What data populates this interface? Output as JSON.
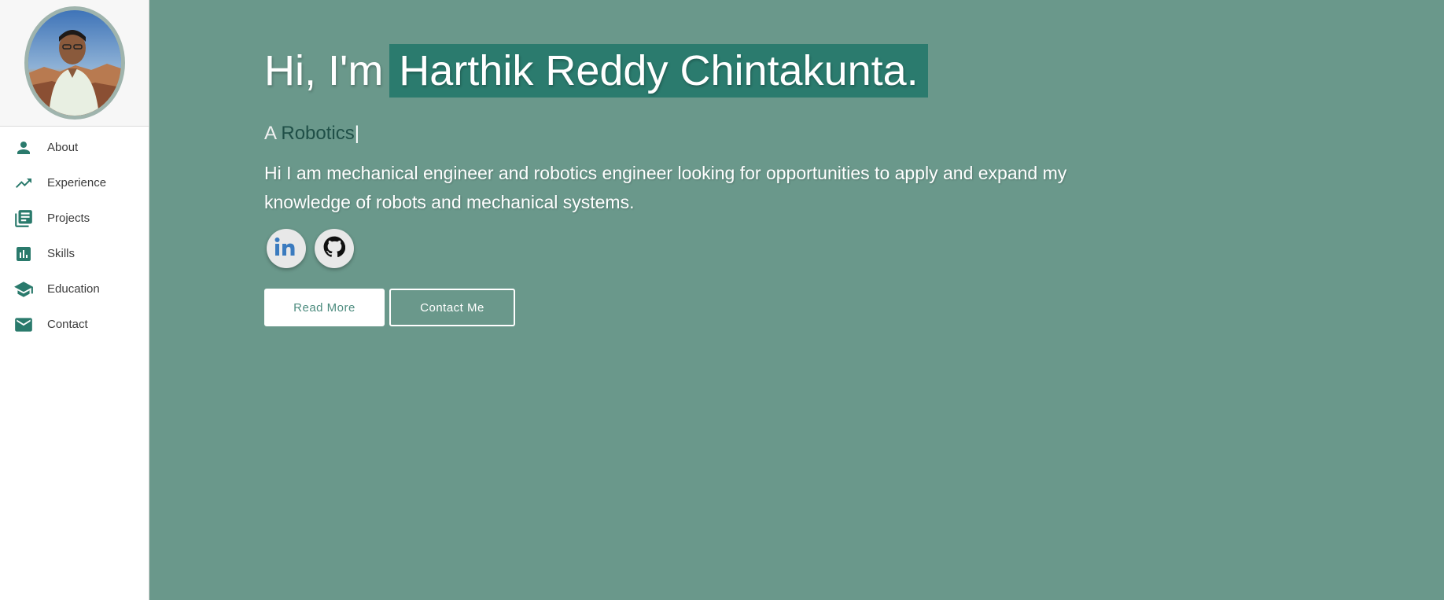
{
  "sidebar": {
    "avatar_alt": "profile photo",
    "items": [
      {
        "label": "About",
        "icon": "person-icon"
      },
      {
        "label": "Experience",
        "icon": "trending-up-icon"
      },
      {
        "label": "Projects",
        "icon": "library-books-icon"
      },
      {
        "label": "Skills",
        "icon": "bar-chart-icon"
      },
      {
        "label": "Education",
        "icon": "school-icon"
      },
      {
        "label": "Contact",
        "icon": "mail-icon"
      }
    ]
  },
  "hero": {
    "greeting": "Hi, I'm",
    "name": "Harthik Reddy Chintakunta.",
    "typed_prefix": "A",
    "typed_role": "Robotics",
    "typed_cursor": "|",
    "bio": "Hi I am mechanical engineer and robotics engineer looking for opportunities to apply and expand my knowledge of robots and mechanical systems.",
    "socials": [
      {
        "name": "LinkedIn",
        "icon": "linkedin-icon"
      },
      {
        "name": "GitHub",
        "icon": "github-icon"
      }
    ],
    "primary_button": "Read More",
    "secondary_button": "Contact Me"
  },
  "colors": {
    "main_bg": "#6a988b",
    "accent": "#2b7b6e",
    "sidebar_bg": "#ffffff",
    "icon_color": "#2a7a6c"
  }
}
